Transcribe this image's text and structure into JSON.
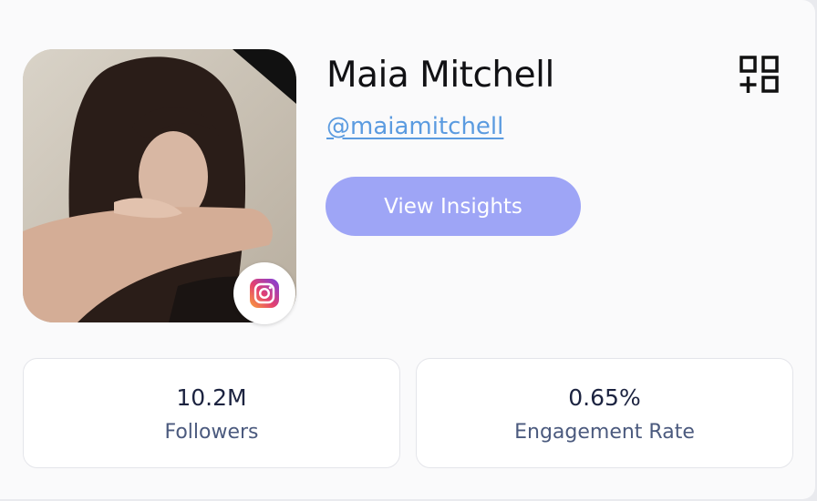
{
  "profile": {
    "name": "Maia Mitchell",
    "handle": "@maiamitchell",
    "platform_icon": "instagram-icon",
    "avatar_alt": "Profile photo"
  },
  "actions": {
    "view_insights_label": "View Insights",
    "add_icon": "add-to-collection-icon"
  },
  "stats": [
    {
      "value": "10.2M",
      "label": "Followers"
    },
    {
      "value": "0.65%",
      "label": "Engagement Rate"
    }
  ],
  "colors": {
    "button_bg": "#9ea5f6",
    "handle_link": "#5b9be0",
    "stat_value": "#1c2340",
    "stat_label": "#4b5a7e"
  }
}
